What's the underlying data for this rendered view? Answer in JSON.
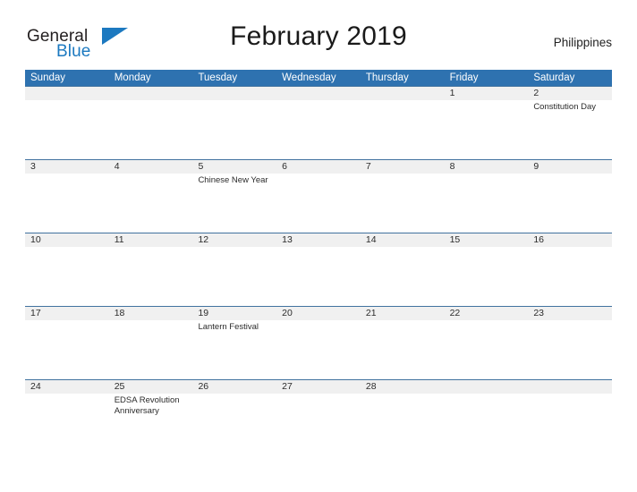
{
  "brand": {
    "name_part1": "General",
    "name_part2": "Blue",
    "flag_icon": "blue-flag-triangle",
    "color_primary": "#1c79c0",
    "color_text": "#231f20"
  },
  "header": {
    "title": "February 2019",
    "country": "Philippines"
  },
  "calendar": {
    "header_color": "#2e72b0",
    "band_color": "#f0f0f0",
    "separator_color": "#41729f",
    "weekdays": [
      "Sunday",
      "Monday",
      "Tuesday",
      "Wednesday",
      "Thursday",
      "Friday",
      "Saturday"
    ],
    "weeks": [
      [
        {
          "num": "",
          "event": ""
        },
        {
          "num": "",
          "event": ""
        },
        {
          "num": "",
          "event": ""
        },
        {
          "num": "",
          "event": ""
        },
        {
          "num": "",
          "event": ""
        },
        {
          "num": "1",
          "event": ""
        },
        {
          "num": "2",
          "event": "Constitution Day"
        }
      ],
      [
        {
          "num": "3",
          "event": ""
        },
        {
          "num": "4",
          "event": ""
        },
        {
          "num": "5",
          "event": "Chinese New Year"
        },
        {
          "num": "6",
          "event": ""
        },
        {
          "num": "7",
          "event": ""
        },
        {
          "num": "8",
          "event": ""
        },
        {
          "num": "9",
          "event": ""
        }
      ],
      [
        {
          "num": "10",
          "event": ""
        },
        {
          "num": "11",
          "event": ""
        },
        {
          "num": "12",
          "event": ""
        },
        {
          "num": "13",
          "event": ""
        },
        {
          "num": "14",
          "event": ""
        },
        {
          "num": "15",
          "event": ""
        },
        {
          "num": "16",
          "event": ""
        }
      ],
      [
        {
          "num": "17",
          "event": ""
        },
        {
          "num": "18",
          "event": ""
        },
        {
          "num": "19",
          "event": "Lantern Festival"
        },
        {
          "num": "20",
          "event": ""
        },
        {
          "num": "21",
          "event": ""
        },
        {
          "num": "22",
          "event": ""
        },
        {
          "num": "23",
          "event": ""
        }
      ],
      [
        {
          "num": "24",
          "event": ""
        },
        {
          "num": "25",
          "event": "EDSA Revolution Anniversary"
        },
        {
          "num": "26",
          "event": ""
        },
        {
          "num": "27",
          "event": ""
        },
        {
          "num": "28",
          "event": ""
        },
        {
          "num": "",
          "event": ""
        },
        {
          "num": "",
          "event": ""
        }
      ]
    ]
  }
}
